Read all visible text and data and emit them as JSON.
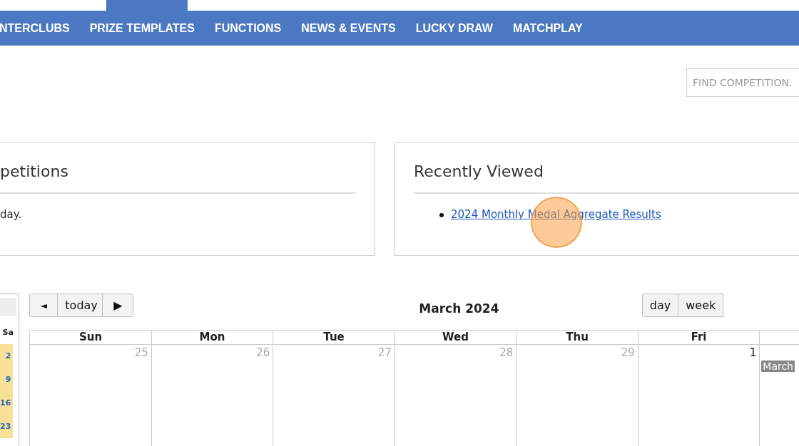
{
  "nav": {
    "items": [
      {
        "label": "NTERCLUBS",
        "selected": false
      },
      {
        "label": "PRIZE TEMPLATES",
        "selected": false
      },
      {
        "label": "FUNCTIONS",
        "selected": false
      },
      {
        "label": "NEWS & EVENTS",
        "selected": false
      },
      {
        "label": "LUCKY DRAW",
        "selected": false
      },
      {
        "label": "MATCHPLAY",
        "selected": false
      }
    ]
  },
  "search": {
    "placeholder": "FIND COMPETITION."
  },
  "panels": [
    {
      "title": "petitions",
      "body": "day."
    },
    {
      "title": "Recently Viewed",
      "links": [
        "2024 Monthly Medal Aggregate Results"
      ]
    }
  ],
  "mini_calendar": {
    "day_header": "Sa",
    "days": [
      "2",
      "9",
      "16",
      "23"
    ]
  },
  "calendar": {
    "nav_buttons": [
      {
        "kind": "prev",
        "label": "◄"
      },
      {
        "kind": "today",
        "label": "today"
      },
      {
        "kind": "next",
        "label": "▶"
      }
    ],
    "title": "March 2024",
    "view_buttons": [
      {
        "label": "day",
        "selected": false
      },
      {
        "label": "week",
        "selected": false
      }
    ],
    "columns": [
      "Sun",
      "Mon",
      "Tue",
      "Wed",
      "Thu",
      "Fri",
      ""
    ],
    "days": [
      {
        "number": "25",
        "other_month": true
      },
      {
        "number": "26",
        "other_month": true
      },
      {
        "number": "27",
        "other_month": true
      },
      {
        "number": "28",
        "other_month": true
      },
      {
        "number": "29",
        "other_month": true
      },
      {
        "number": "1",
        "other_month": false
      },
      {
        "event": "March"
      }
    ]
  }
}
